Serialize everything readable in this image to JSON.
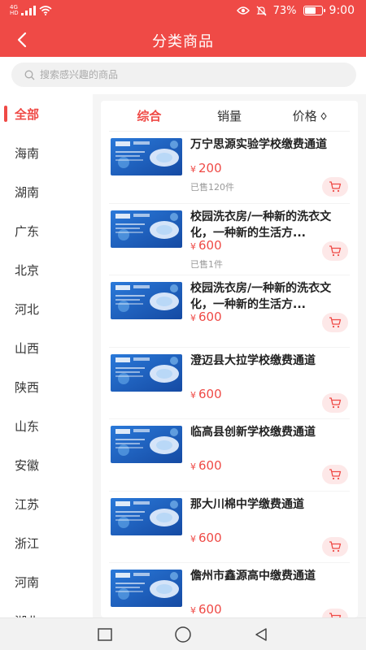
{
  "status_bar": {
    "network_tag_top": "4G",
    "network_tag_bottom": "HD",
    "battery_percent": "73%",
    "time": "9:00",
    "battery_level": 0.73
  },
  "header": {
    "title": "分类商品",
    "back_icon": "chevron-left-icon"
  },
  "search": {
    "placeholder": "搜索感兴趣的商品"
  },
  "sidebar": {
    "items": [
      {
        "label": "全部",
        "active": true
      },
      {
        "label": "海南",
        "active": false
      },
      {
        "label": "湖南",
        "active": false
      },
      {
        "label": "广东",
        "active": false
      },
      {
        "label": "北京",
        "active": false
      },
      {
        "label": "河北",
        "active": false
      },
      {
        "label": "山西",
        "active": false
      },
      {
        "label": "陕西",
        "active": false
      },
      {
        "label": "山东",
        "active": false
      },
      {
        "label": "安徽",
        "active": false
      },
      {
        "label": "江苏",
        "active": false
      },
      {
        "label": "浙江",
        "active": false
      },
      {
        "label": "河南",
        "active": false
      },
      {
        "label": "湖北",
        "active": false
      }
    ]
  },
  "sort_tabs": [
    {
      "label": "综合",
      "active": true
    },
    {
      "label": "销量",
      "active": false
    },
    {
      "label": "价格",
      "active": false
    }
  ],
  "currency_symbol": "¥",
  "products": [
    {
      "title": "万宁思源实验学校缴费通道",
      "price": "200",
      "sold": "已售120件"
    },
    {
      "title": "校园洗衣房/一种新的洗衣文化，一种新的生活方...",
      "price": "600",
      "sold": "已售1件"
    },
    {
      "title": "校园洗衣房/一种新的洗衣文化，一种新的生活方...",
      "price": "600",
      "sold": ""
    },
    {
      "title": "澄迈县大拉学校缴费通道",
      "price": "600",
      "sold": ""
    },
    {
      "title": "临高县创新学校缴费通道",
      "price": "600",
      "sold": ""
    },
    {
      "title": "那大川棉中学缴费通道",
      "price": "600",
      "sold": ""
    },
    {
      "title": "儋州市鑫源高中缴费通道",
      "price": "600",
      "sold": ""
    }
  ],
  "colors": {
    "brand": "#ef4a46",
    "cart_bg": "#fde8e8",
    "thumb_bg": "#1f5cc4"
  }
}
